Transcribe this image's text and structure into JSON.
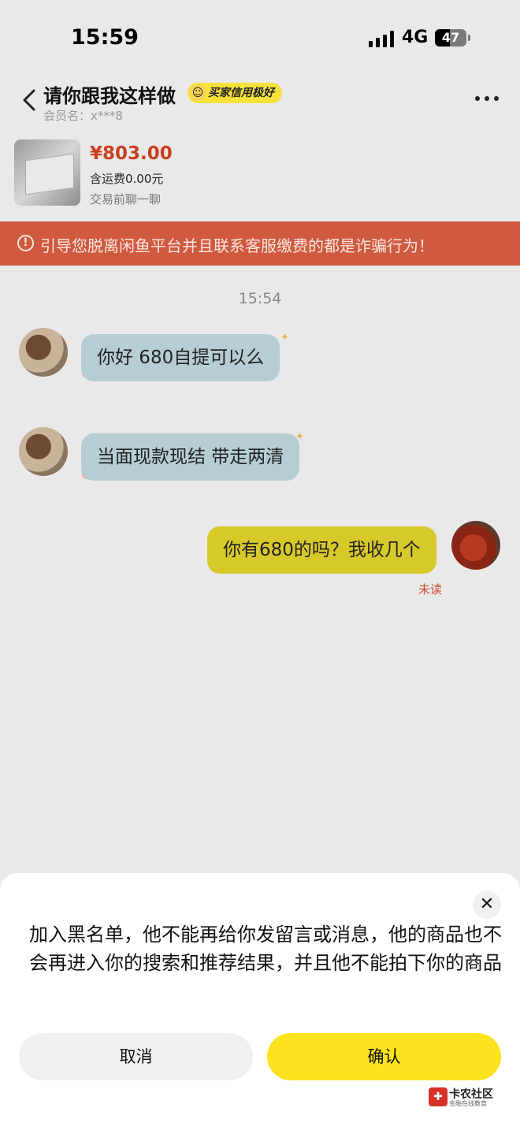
{
  "status_bar": {
    "time": "15:59",
    "network": "4G",
    "battery": "47"
  },
  "header": {
    "title": "请你跟我这样做",
    "credit_badge": "买家信用极好",
    "member_name": "会员名：x***8"
  },
  "product": {
    "price": "¥803.00",
    "shipping": "含运费0.00元",
    "hint": "交易前聊一聊"
  },
  "warning": {
    "text": "引导您脱离闲鱼平台并且联系客服缴费的都是诈骗行为！"
  },
  "chat": {
    "time_divider": "15:54",
    "messages": [
      {
        "direction": "in",
        "text": "你好  680自提可以么"
      },
      {
        "direction": "in",
        "text": "当面现款现结 带走两清"
      },
      {
        "direction": "out",
        "text": "你有680的吗？我收几个"
      }
    ],
    "read_status": "未读"
  },
  "dialog": {
    "message": "加入黑名单，他不能再给你发留言或消息，他的商品也不会再进入你的搜索和推荐结果，并且他不能拍下你的商品",
    "cancel_label": "取消",
    "confirm_label": "确认"
  },
  "watermark": {
    "title": "卡农社区",
    "subtitle": "金融在线教育"
  },
  "icons": {
    "back": "chevron-left-icon",
    "more": "more-dots-icon",
    "warning": "exclamation-circle-icon",
    "close": "close-icon"
  },
  "colors": {
    "warning_bg": "#cf5a40",
    "price": "#c9401f",
    "incoming_bubble": "#b7cdd4",
    "outgoing_bubble": "#d8c92a",
    "confirm_button": "#fce31d",
    "read_status": "#d0492e"
  }
}
